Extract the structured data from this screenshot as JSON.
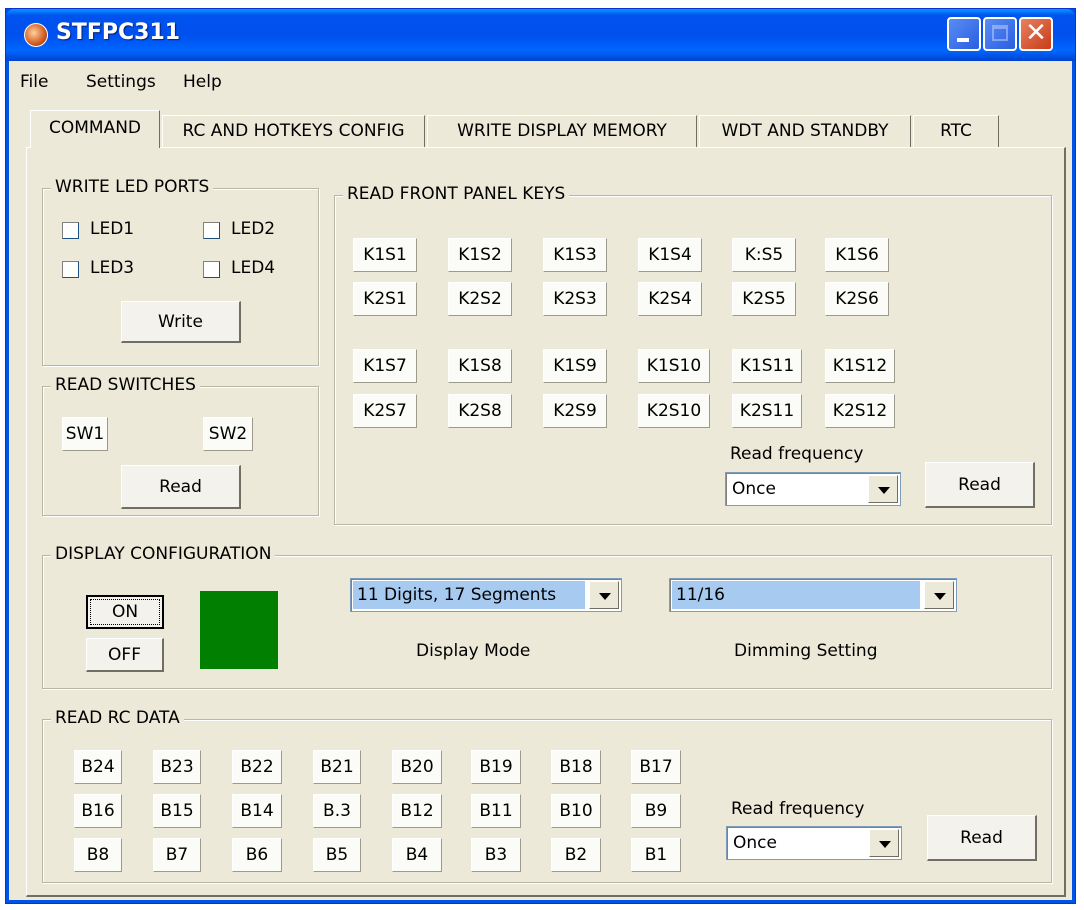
{
  "window": {
    "title": "STFPC311"
  },
  "menu": [
    "File",
    "Settings",
    "Help"
  ],
  "tabs": [
    "COMMAND",
    "RC AND HOTKEYS CONFIG",
    "WRITE DISPLAY MEMORY",
    "WDT AND STANDBY",
    "RTC"
  ],
  "write_led_ports": {
    "label": "WRITE LED PORTS",
    "leds": [
      "LED1",
      "LED2",
      "LED3",
      "LED4"
    ],
    "button": "Write"
  },
  "read_switches": {
    "label": "READ SWITCHES",
    "switches": [
      "SW1",
      "SW2"
    ],
    "button": "Read"
  },
  "read_front_panel_keys": {
    "label": "READ FRONT PANEL KEYS",
    "rows": [
      [
        "K1S1",
        "K1S2",
        "K1S3",
        "K1S4",
        "K:S5",
        "K1S6"
      ],
      [
        "K2S1",
        "K2S2",
        "K2S3",
        "K2S4",
        "K2S5",
        "K2S6"
      ],
      [
        "K1S7",
        "K1S8",
        "K1S9",
        "K1S10",
        "K1S11",
        "K1S12"
      ],
      [
        "K2S7",
        "K2S8",
        "K2S9",
        "K2S10",
        "K2S11",
        "K2S12"
      ]
    ],
    "read_frequency_label": "Read frequency",
    "read_frequency_value": "Once",
    "button": "Read"
  },
  "display_configuration": {
    "label": "DISPLAY CONFIGURATION",
    "on_button": "ON",
    "off_button": "OFF",
    "indicator_color": "#007f00",
    "display_mode_value": "11 Digits, 17 Segments",
    "display_mode_label": "Display Mode",
    "dimming_value": "11/16",
    "dimming_label": "Dimming Setting"
  },
  "read_rc_data": {
    "label": "READ RC DATA",
    "rows": [
      [
        "B24",
        "B23",
        "B22",
        "B21",
        "B20",
        "B19",
        "B18",
        "B17"
      ],
      [
        "B16",
        "B15",
        "B14",
        "B.3",
        "B12",
        "B11",
        "B10",
        "B9"
      ],
      [
        "B8",
        "B7",
        "B6",
        "B5",
        "B4",
        "B3",
        "B2",
        "B1"
      ]
    ],
    "read_frequency_label": "Read frequency",
    "read_frequency_value": "Once",
    "button": "Read"
  }
}
